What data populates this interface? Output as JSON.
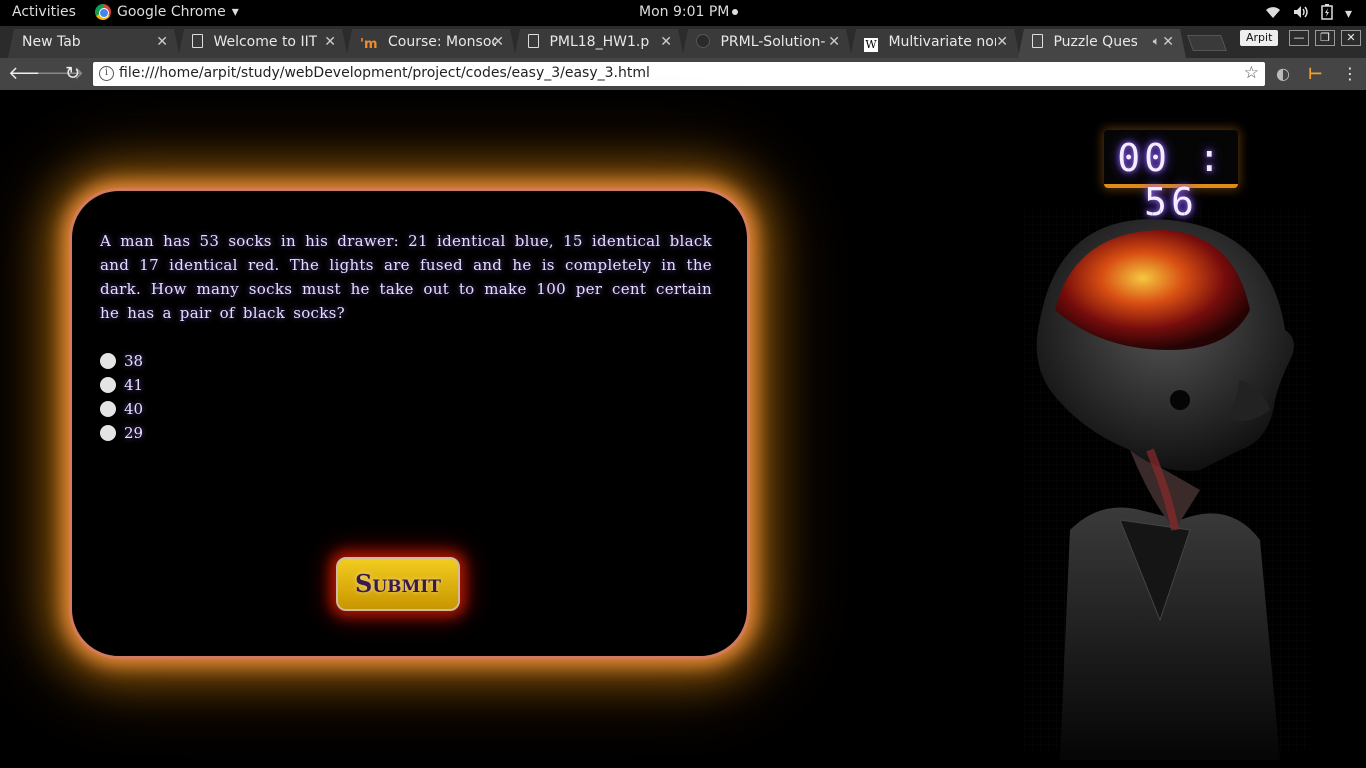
{
  "system": {
    "activities": "Activities",
    "app_name": "Google Chrome",
    "clock": "Mon  9:01 PM"
  },
  "tabs": [
    {
      "title": "New Tab",
      "icon": "none"
    },
    {
      "title": "Welcome to IIT",
      "icon": "document-icon"
    },
    {
      "title": "Course: Monsoo",
      "icon": "monsoon-icon"
    },
    {
      "title": "PML18_HW1.p",
      "icon": "document-icon"
    },
    {
      "title": "PRML-Solution-",
      "icon": "github-icon"
    },
    {
      "title": "Multivariate nor",
      "icon": "wikipedia-icon"
    },
    {
      "title": "Puzzle Quest",
      "icon": "document-icon",
      "active": true
    }
  ],
  "window": {
    "profile": "Arpit"
  },
  "toolbar": {
    "url": "file:///home/arpit/study/webDevelopment/project/codes/easy_3/easy_3.html"
  },
  "quiz": {
    "question": "A man has 53 socks in his drawer: 21 identical blue, 15 identical black and 17 identical red. The lights are fused and he is completely in the dark. How many socks must he take out to make 100 per cent certain he has a pair of black socks?",
    "options": [
      "38",
      "41",
      "40",
      "29"
    ],
    "submit_label": "Submit"
  },
  "timer": {
    "display": "00 : 56"
  },
  "colors": {
    "card_glow": "#e88a3a",
    "submit_bg": "#f2cc20",
    "text_glow": "#a070ff"
  }
}
